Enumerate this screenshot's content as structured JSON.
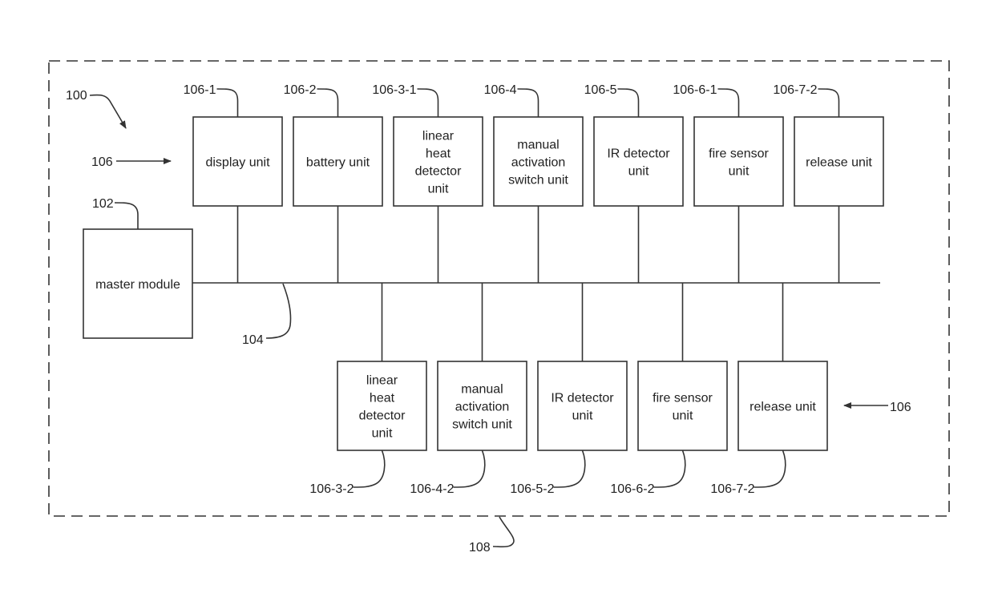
{
  "figure": {
    "system_ref": "100",
    "enclosure_ref": "108",
    "bus_ref": "104",
    "unit_group_ref": "106",
    "master": {
      "ref": "102",
      "label": "master module"
    },
    "top_units": [
      {
        "ref": "106-1",
        "lines": [
          "display unit"
        ]
      },
      {
        "ref": "106-2",
        "lines": [
          "battery unit"
        ]
      },
      {
        "ref": "106-3-1",
        "lines": [
          "linear",
          "heat",
          "detector",
          "unit"
        ]
      },
      {
        "ref": "106-4",
        "lines": [
          "manual",
          "activation",
          "switch unit"
        ]
      },
      {
        "ref": "106-5",
        "lines": [
          "IR detector",
          "unit"
        ]
      },
      {
        "ref": "106-6-1",
        "lines": [
          "fire sensor",
          "unit"
        ]
      },
      {
        "ref": "106-7-2",
        "lines": [
          "release unit"
        ]
      }
    ],
    "bottom_units": [
      {
        "ref": "106-3-2",
        "lines": [
          "linear",
          "heat",
          "detector",
          "unit"
        ]
      },
      {
        "ref": "106-4-2",
        "lines": [
          "manual",
          "activation",
          "switch unit"
        ]
      },
      {
        "ref": "106-5-2",
        "lines": [
          "IR detector",
          "unit"
        ]
      },
      {
        "ref": "106-6-2",
        "lines": [
          "fire sensor",
          "unit"
        ]
      },
      {
        "ref": "106-7-2",
        "lines": [
          "release unit"
        ]
      }
    ]
  }
}
